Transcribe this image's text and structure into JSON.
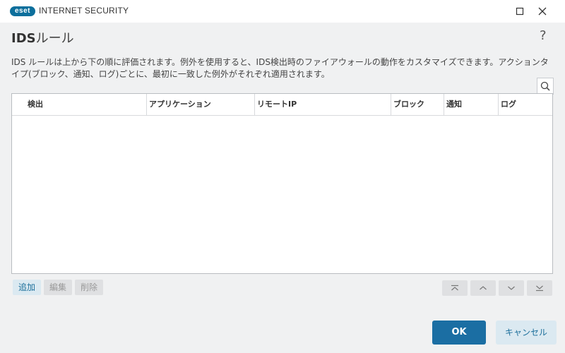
{
  "window": {
    "brand": "eset",
    "product": "INTERNET SECURITY",
    "minimize_icon": "minimize-icon",
    "maximize_icon": "maximize-icon",
    "close_icon": "close-icon"
  },
  "header": {
    "title_bold": "IDS",
    "title_rest": "ルール",
    "help": "?"
  },
  "description": "IDS ルールは上から下の順に評価されます。例外を使用すると、IDS検出時のファイアウォールの動作をカスタマイズできます。アクションタイプ(ブロック、通知、ログ)ごとに、最初に一致した例外がそれぞれ適用されます。",
  "table": {
    "columns": [
      "検出",
      "アプリケーション",
      "リモートIP",
      "ブロック",
      "通知",
      "ログ"
    ],
    "rows": []
  },
  "actions": {
    "add": "追加",
    "edit": "編集",
    "delete": "削除"
  },
  "navigation": {
    "icons": [
      "move-top-icon",
      "move-up-icon",
      "move-down-icon",
      "move-bottom-icon"
    ]
  },
  "footer": {
    "ok": "OK",
    "cancel": "キャンセル"
  },
  "colors": {
    "accent": "#1b6ea3",
    "brand": "#0c6f9c"
  }
}
